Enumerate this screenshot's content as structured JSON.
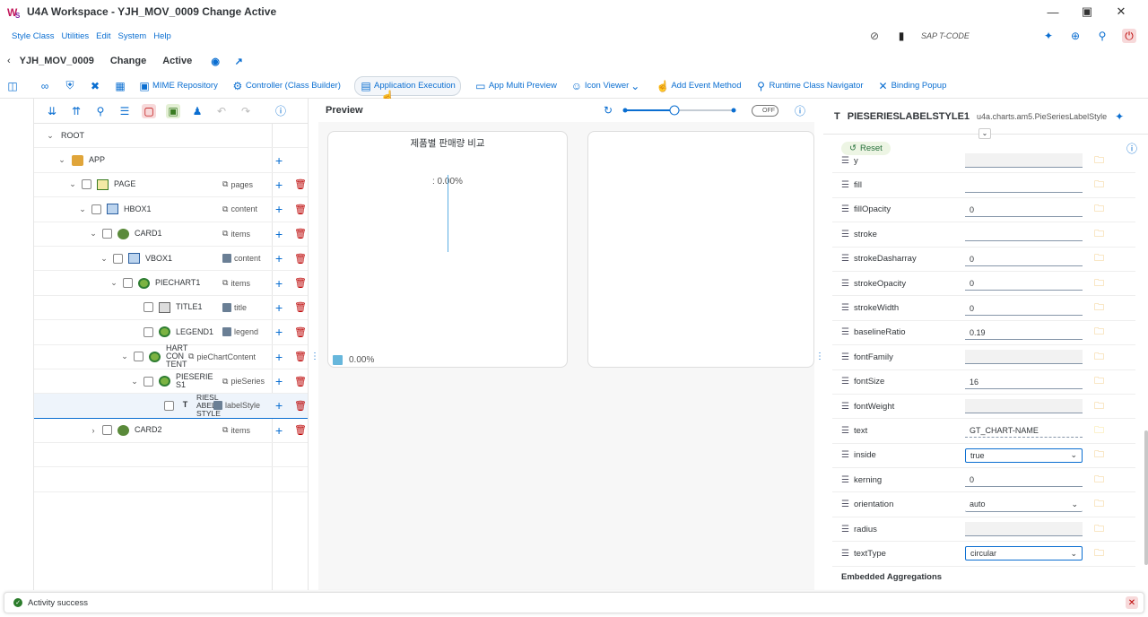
{
  "window": {
    "title": "U4A Workspace - YJH_MOV_0009 Change Active"
  },
  "menu": {
    "items": [
      "Style Class",
      "Utilities",
      "Edit",
      "System",
      "Help"
    ],
    "tcode_placeholder": "SAP T-CODE"
  },
  "page_header": {
    "app_id": "YJH_MOV_0009",
    "mode": "Change",
    "status": "Active"
  },
  "toolbar": {
    "mime": "MIME Repository",
    "controller": "Controller (Class Builder)",
    "app_exec": "Application Execution",
    "multi_preview": "App Multi Preview",
    "icon_viewer": "Icon Viewer",
    "add_event": "Add Event Method",
    "runtime_nav": "Runtime Class Navigator",
    "binding_popup": "Binding Popup"
  },
  "tree": {
    "rows": [
      {
        "name": "ROOT",
        "agg": ""
      },
      {
        "name": "APP",
        "agg": ""
      },
      {
        "name": "PAGE",
        "agg": "pages"
      },
      {
        "name": "HBOX1",
        "agg": "content"
      },
      {
        "name": "CARD1",
        "agg": "items"
      },
      {
        "name": "VBOX1",
        "agg": "content"
      },
      {
        "name": "PIECHART1",
        "agg": "items"
      },
      {
        "name": "TITLE1",
        "agg": "title"
      },
      {
        "name": "LEGEND1",
        "agg": "legend"
      },
      {
        "name": "HART CON TENT",
        "agg": "pieChartContent"
      },
      {
        "name": "PIESERIE S1",
        "agg": "pieSeries"
      },
      {
        "name": "RIESL ABEL STYLE",
        "agg": "labelStyle"
      },
      {
        "name": "CARD2",
        "agg": "items"
      }
    ]
  },
  "preview": {
    "title": "Preview",
    "toggle": "OFF",
    "chart_title": "제품별 판매량 비교",
    "chart_label": ": 0.00%",
    "legend_value": "0.00%"
  },
  "props": {
    "name": "PIESERIESLABELSTYLE1",
    "class": "u4a.charts.am5.PieSeriesLabelStyle",
    "reset": "Reset",
    "rows": [
      {
        "label": "y",
        "value": ""
      },
      {
        "label": "fill",
        "value": ""
      },
      {
        "label": "fillOpacity",
        "value": "0"
      },
      {
        "label": "stroke",
        "value": ""
      },
      {
        "label": "strokeDasharray",
        "value": "0"
      },
      {
        "label": "strokeOpacity",
        "value": "0"
      },
      {
        "label": "strokeWidth",
        "value": "0"
      },
      {
        "label": "baselineRatio",
        "value": "0.19"
      },
      {
        "label": "fontFamily",
        "value": ""
      },
      {
        "label": "fontSize",
        "value": "16"
      },
      {
        "label": "fontWeight",
        "value": ""
      },
      {
        "label": "text",
        "value": "GT_CHART-NAME"
      },
      {
        "label": "inside",
        "value": "true"
      },
      {
        "label": "kerning",
        "value": "0"
      },
      {
        "label": "orientation",
        "value": "auto"
      },
      {
        "label": "radius",
        "value": ""
      },
      {
        "label": "textType",
        "value": "circular"
      }
    ],
    "embedded": "Embedded Aggregations"
  },
  "status": {
    "message": "Activity success"
  }
}
